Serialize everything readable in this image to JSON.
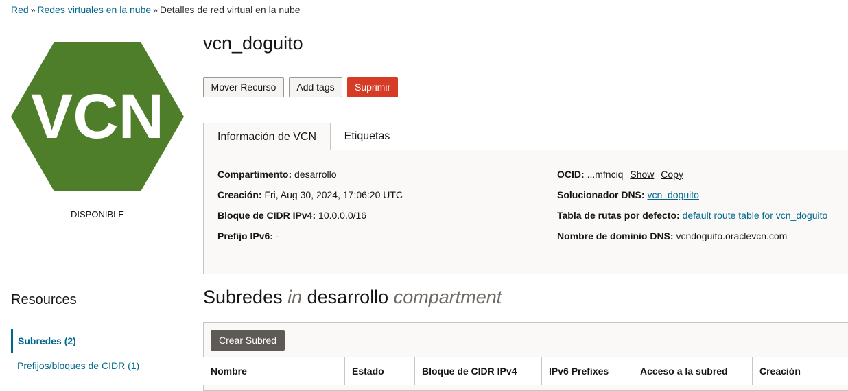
{
  "breadcrumb": {
    "items": [
      "Red",
      "Redes virtuales en la nube"
    ],
    "separator": "»",
    "current": "Detalles de red virtual en la nube"
  },
  "resource": {
    "icon_text": "VCN",
    "icon_color": "#4e7e2a",
    "status": "DISPONIBLE",
    "name": "vcn_doguito"
  },
  "actions": {
    "move": "Mover Recurso",
    "tags": "Add tags",
    "delete": "Suprimir"
  },
  "tabs": {
    "info": "Información de VCN",
    "labels": "Etiquetas"
  },
  "info": {
    "compartment_label": "Compartimento:",
    "compartment_value": "desarrollo",
    "created_label": "Creación:",
    "created_value": "Fri, Aug 30, 2024, 17:06:20 UTC",
    "cidr_label": "Bloque de CIDR IPv4:",
    "cidr_value": "10.0.0.0/16",
    "ipv6_label": "Prefijo IPv6:",
    "ipv6_value": "-",
    "ocid_label": "OCID:",
    "ocid_value": "...mfnciq",
    "ocid_show": "Show",
    "ocid_copy": "Copy",
    "dns_resolver_label": "Solucionador DNS:",
    "dns_resolver_value": "vcn_doguito",
    "route_table_label": "Tabla de rutas por defecto:",
    "route_table_value": "default route table for vcn_doguito",
    "dns_domain_label": "Nombre de dominio DNS:",
    "dns_domain_value": "vcndoguito.oraclevcn.com"
  },
  "subnets": {
    "title_main": "Subredes",
    "title_in": "in",
    "title_compartment": "desarrollo",
    "title_suffix": "compartment",
    "create_button": "Crear Subred",
    "columns": [
      "Nombre",
      "Estado",
      "Bloque de CIDR IPv4",
      "IPv6 Prefixes",
      "Acceso a la subred",
      "Creación"
    ]
  },
  "resources_panel": {
    "title": "Resources",
    "items": [
      "Subredes (2)",
      "Prefijos/bloques de CIDR (1)"
    ]
  }
}
